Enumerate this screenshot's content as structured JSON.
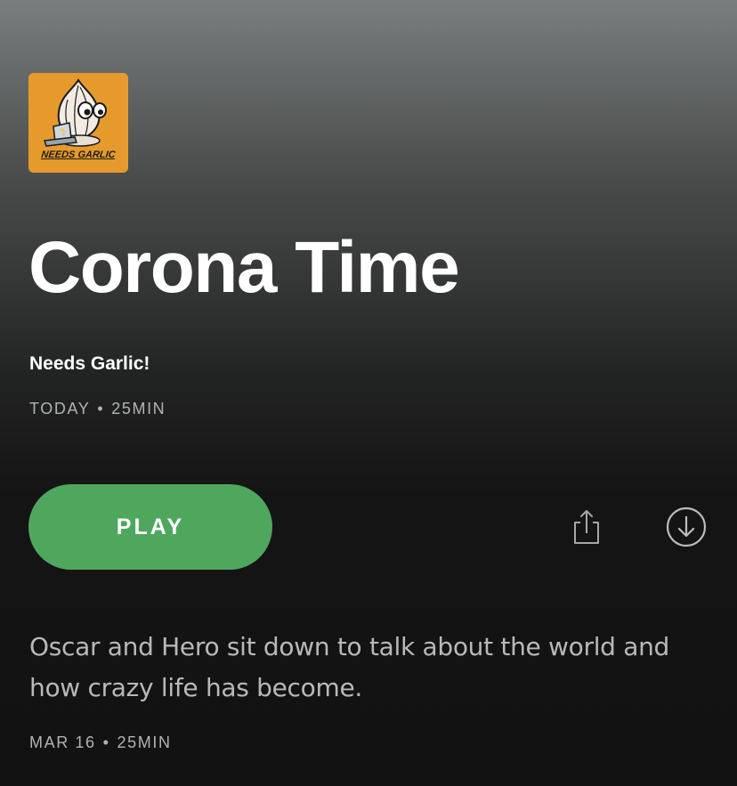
{
  "cover": {
    "text": "NEEDS GARLIC",
    "bg_color": "#e69a2c"
  },
  "episode": {
    "title": "Corona Time",
    "show_name": "Needs Garlic!",
    "date": "TODAY",
    "separator": "•",
    "duration": "25MIN"
  },
  "actions": {
    "play_label": "PLAY",
    "play_color": "#4fa75e",
    "share_icon": "share-icon",
    "download_icon": "download-icon"
  },
  "description": {
    "text": "Oscar and Hero sit down to talk about the world and how crazy life has become.",
    "date": "MAR 16",
    "separator": "•",
    "duration": "25MIN"
  }
}
